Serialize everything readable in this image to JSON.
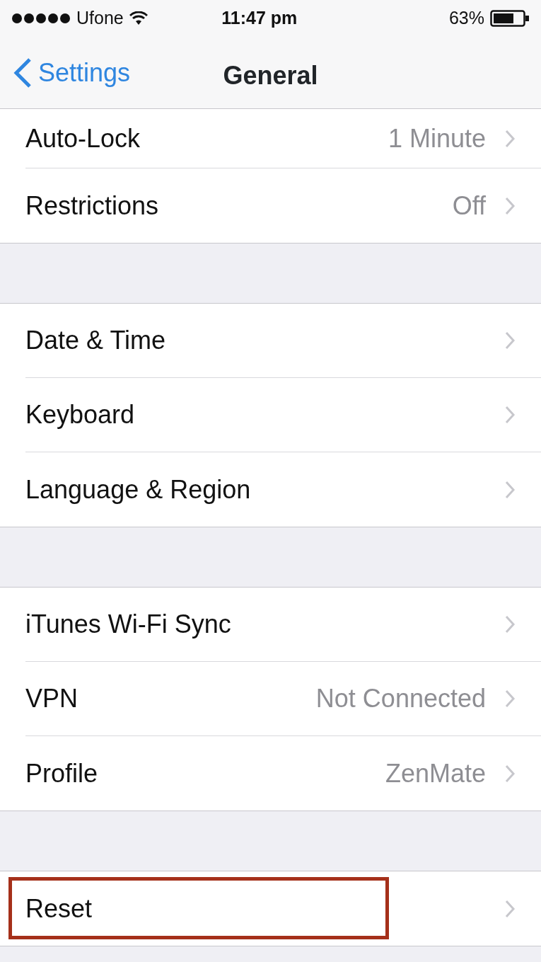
{
  "status_bar": {
    "carrier": "Ufone",
    "time": "11:47 pm",
    "battery": "63%"
  },
  "nav": {
    "back": "Settings",
    "title": "General"
  },
  "groups": [
    {
      "rows": [
        {
          "label": "Auto-Lock",
          "value": "1 Minute",
          "highlighted": false
        },
        {
          "label": "Restrictions",
          "value": "Off",
          "highlighted": false
        }
      ]
    },
    {
      "rows": [
        {
          "label": "Date & Time",
          "highlighted": false
        },
        {
          "label": "Keyboard",
          "highlighted": false
        },
        {
          "label": "Language & Region",
          "highlighted": false
        }
      ]
    },
    {
      "rows": [
        {
          "label": "iTunes Wi-Fi Sync",
          "highlighted": false
        },
        {
          "label": "VPN",
          "value": "Not Connected",
          "highlighted": false
        },
        {
          "label": "Profile",
          "value": "ZenMate",
          "highlighted": false
        }
      ]
    },
    {
      "rows": [
        {
          "label": "Reset",
          "highlighted": true
        }
      ]
    }
  ]
}
